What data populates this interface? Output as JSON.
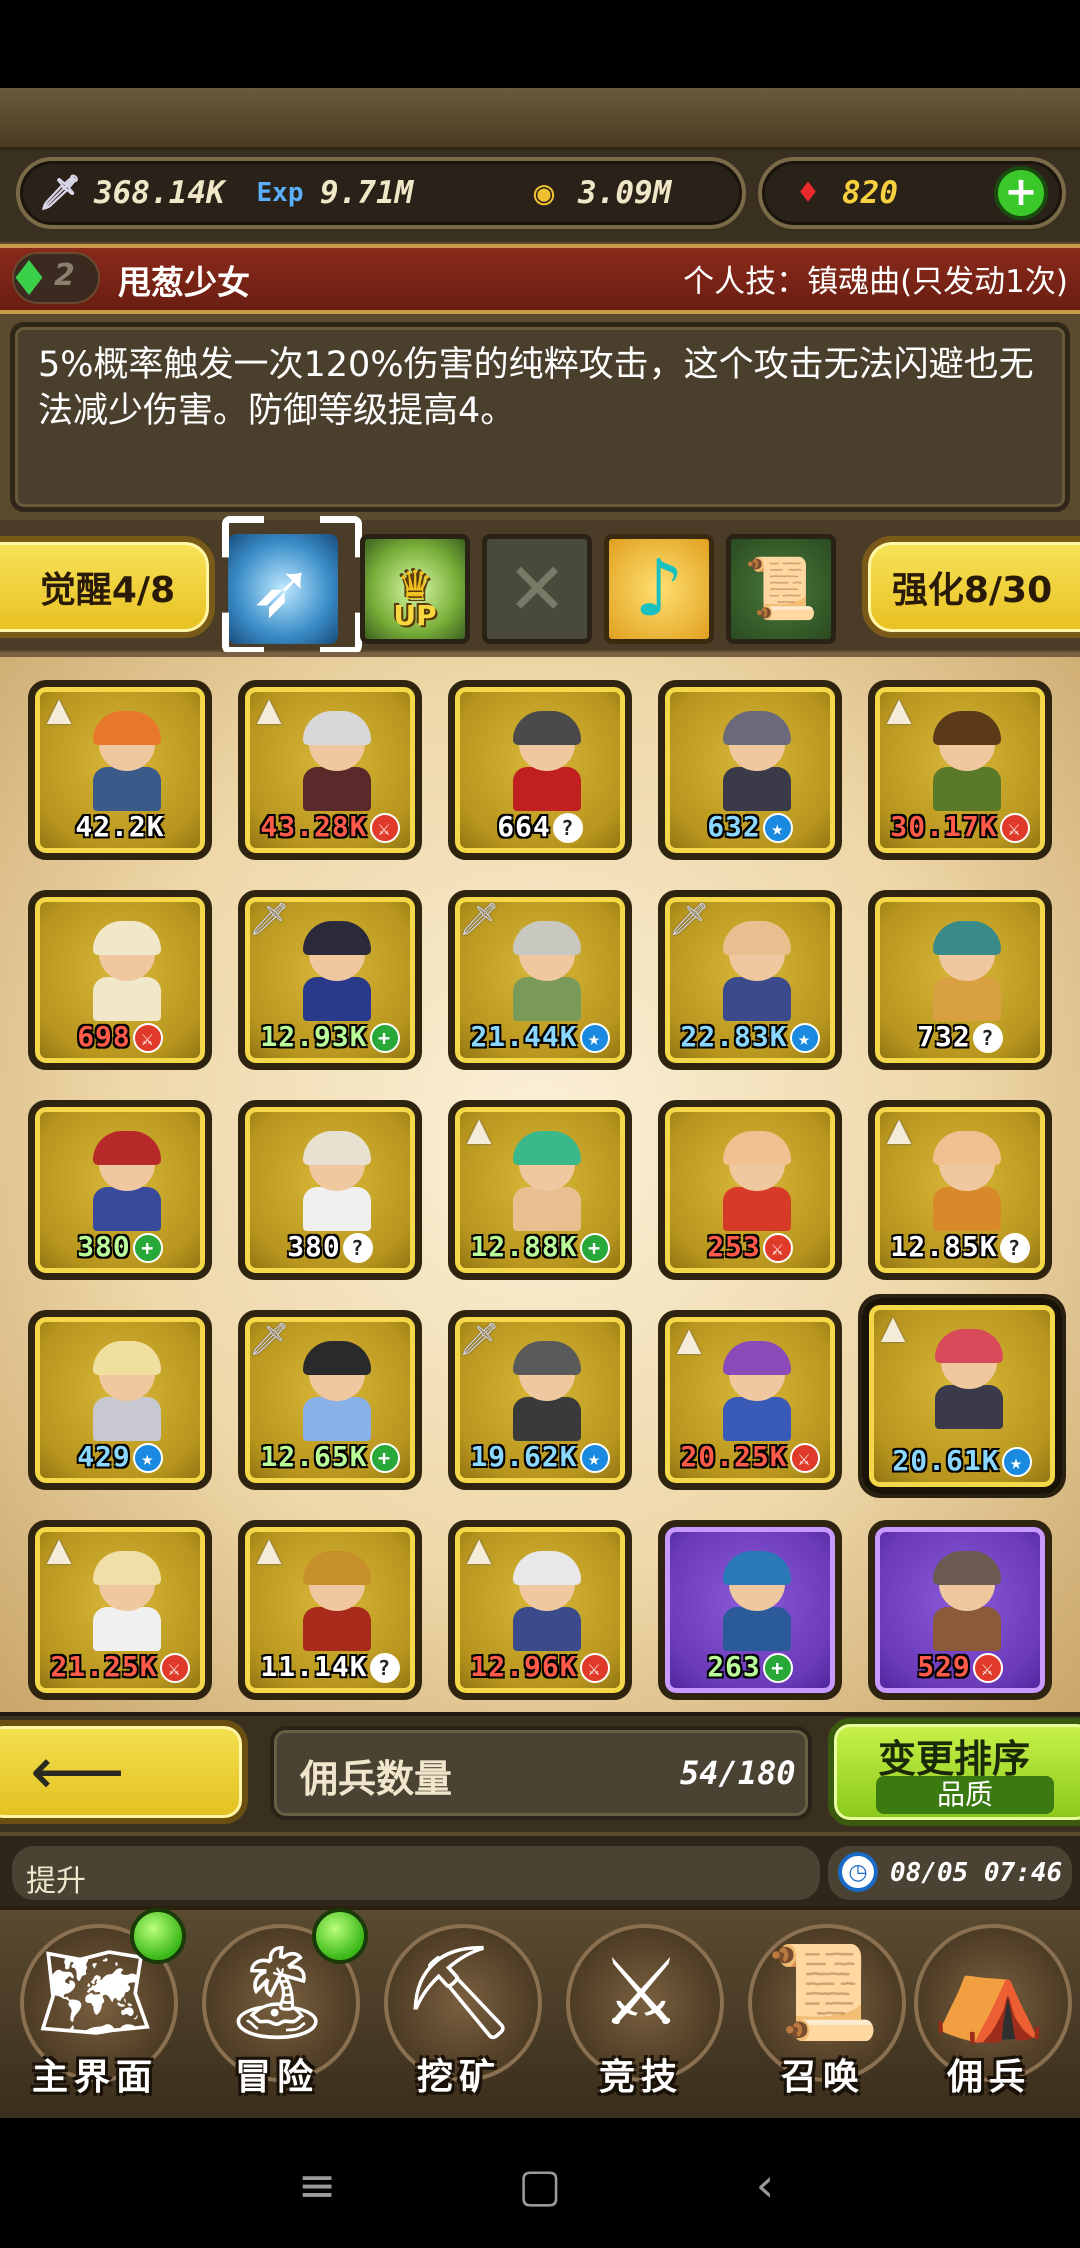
{
  "resources": {
    "attack": "368.14K",
    "exp": "9.71M",
    "gold": "3.09M",
    "gems": "820",
    "icons": [
      "sword-icon",
      "exp-icon",
      "gold-coin-icon",
      "ruby-icon",
      "add-icon"
    ]
  },
  "skill": {
    "level": "2",
    "hero_name": "甩葱少女",
    "label": "个人技：镇魂曲(只发动1次)",
    "description": "5%概率触发一次120%伤害的纯粹攻击，这个攻击无法闪避也无法减少伤害。防御等级提高4。"
  },
  "ability": {
    "awaken": "觉醒4/8",
    "enhance": "强化8/30",
    "icons": [
      "bow-skill-icon",
      "up-crown-icon",
      "locked-x-icon",
      "music-note-icon",
      "scroll-icon"
    ]
  },
  "heroes": [
    {
      "power": "42.2K",
      "color": "white",
      "badge": "",
      "corner": "tent",
      "bg": "gold",
      "hair": "#e8782a",
      "body": "#3a5a8a"
    },
    {
      "power": "43.28K",
      "color": "red",
      "badge": "sword",
      "corner": "tent",
      "bg": "gold",
      "hair": "#d8d8d8",
      "body": "#5a2a2a"
    },
    {
      "power": "664",
      "color": "white",
      "badge": "?",
      "corner": "",
      "bg": "gold",
      "hair": "#4a4a4a",
      "body": "#c02020"
    },
    {
      "power": "632",
      "color": "blue",
      "badge": "star",
      "corner": "",
      "bg": "gold",
      "hair": "#6a6a7a",
      "body": "#3a3a48"
    },
    {
      "power": "30.17K",
      "color": "red",
      "badge": "sword",
      "corner": "tent",
      "bg": "gold",
      "hair": "#5a3a18",
      "body": "#5a7a2a"
    },
    {
      "power": "698",
      "color": "red",
      "badge": "sword",
      "corner": "",
      "bg": "gold",
      "hair": "#f0e8c8",
      "body": "#f0e8c8"
    },
    {
      "power": "12.93K",
      "color": "green",
      "badge": "+",
      "corner": "sword",
      "bg": "gold",
      "hair": "#2a2a3a",
      "body": "#2a3a8a"
    },
    {
      "power": "21.44K",
      "color": "blue",
      "badge": "star",
      "corner": "sword",
      "bg": "gold",
      "hair": "#c8c8c0",
      "body": "#7a9a5a"
    },
    {
      "power": "22.83K",
      "color": "blue",
      "badge": "star",
      "corner": "sword",
      "bg": "gold",
      "hair": "#e8c090",
      "body": "#3a4a8a"
    },
    {
      "power": "732",
      "color": "white",
      "badge": "?",
      "corner": "",
      "bg": "gold",
      "hair": "#3a8a8a",
      "body": "#d8a040"
    },
    {
      "power": "380",
      "color": "green",
      "badge": "+",
      "corner": "",
      "bg": "gold",
      "hair": "#b82a2a",
      "body": "#3a4a9a"
    },
    {
      "power": "380",
      "color": "white",
      "badge": "?",
      "corner": "",
      "bg": "gold",
      "hair": "#e8e0d0",
      "body": "#f0f0f0"
    },
    {
      "power": "12.88K",
      "color": "green",
      "badge": "+",
      "corner": "tent",
      "bg": "gold",
      "hair": "#3ab88a",
      "body": "#e8c090"
    },
    {
      "power": "253",
      "color": "red",
      "badge": "sword",
      "corner": "",
      "bg": "gold",
      "hair": "#f0c090",
      "body": "#d83a2a"
    },
    {
      "power": "12.85K",
      "color": "white",
      "badge": "?",
      "corner": "tent",
      "bg": "gold",
      "hair": "#f0c090",
      "body": "#d88a2a"
    },
    {
      "power": "429",
      "color": "blue",
      "badge": "star",
      "corner": "",
      "bg": "gold",
      "hair": "#f0e0a0",
      "body": "#c8c8d0"
    },
    {
      "power": "12.65K",
      "color": "green",
      "badge": "+",
      "corner": "sword",
      "bg": "gold",
      "hair": "#2a2a2a",
      "body": "#8ab0e8"
    },
    {
      "power": "19.62K",
      "color": "blue",
      "badge": "star",
      "corner": "sword",
      "bg": "gold",
      "hair": "#5a5a5a",
      "body": "#3a3a3a"
    },
    {
      "power": "20.25K",
      "color": "red",
      "badge": "sword",
      "corner": "tent",
      "bg": "gold",
      "hair": "#8a4ab8",
      "body": "#3a5ab8"
    },
    {
      "power": "20.61K",
      "color": "blue",
      "badge": "star",
      "corner": "tent",
      "bg": "gold",
      "hair": "#d84a5a",
      "body": "#3a3a4a",
      "selected": true
    },
    {
      "power": "21.25K",
      "color": "red",
      "badge": "sword",
      "corner": "tent",
      "bg": "gold",
      "hair": "#f0e0a8",
      "body": "#f0f0f0"
    },
    {
      "power": "11.14K",
      "color": "white",
      "badge": "?",
      "corner": "tent",
      "bg": "gold",
      "hair": "#c8902a",
      "body": "#a82a1a"
    },
    {
      "power": "12.96K",
      "color": "red",
      "badge": "sword",
      "corner": "tent",
      "bg": "gold",
      "hair": "#e8e8e8",
      "body": "#3a4a8a"
    },
    {
      "power": "263",
      "color": "green",
      "badge": "+",
      "corner": "",
      "bg": "purple",
      "hair": "#2a7ab8",
      "body": "#2a5a9a"
    },
    {
      "power": "529",
      "color": "red",
      "badge": "sword",
      "corner": "",
      "bg": "purple",
      "hair": "#6a5a50",
      "body": "#8a5a3a"
    }
  ],
  "bottom": {
    "count_label": "佣兵数量",
    "count_value": "54/180",
    "sort_label": "变更排序",
    "sort_sub": "品质",
    "tip": "提升",
    "time": "08/05 07:46"
  },
  "nav": [
    {
      "label": "主界面",
      "icon": "map-scroll-icon",
      "glyph": "🗺",
      "dot": true
    },
    {
      "label": "冒险",
      "icon": "island-icon",
      "glyph": "🏝",
      "dot": true
    },
    {
      "label": "挖矿",
      "icon": "pickaxe-icon",
      "glyph": "⛏",
      "dot": false
    },
    {
      "label": "竞技",
      "icon": "crossed-swords-icon",
      "glyph": "⚔",
      "dot": false
    },
    {
      "label": "召唤",
      "icon": "summon-scroll-icon",
      "glyph": "📜",
      "dot": false
    },
    {
      "label": "佣兵",
      "icon": "tent-icon",
      "glyph": "⛺",
      "dot": false
    }
  ]
}
